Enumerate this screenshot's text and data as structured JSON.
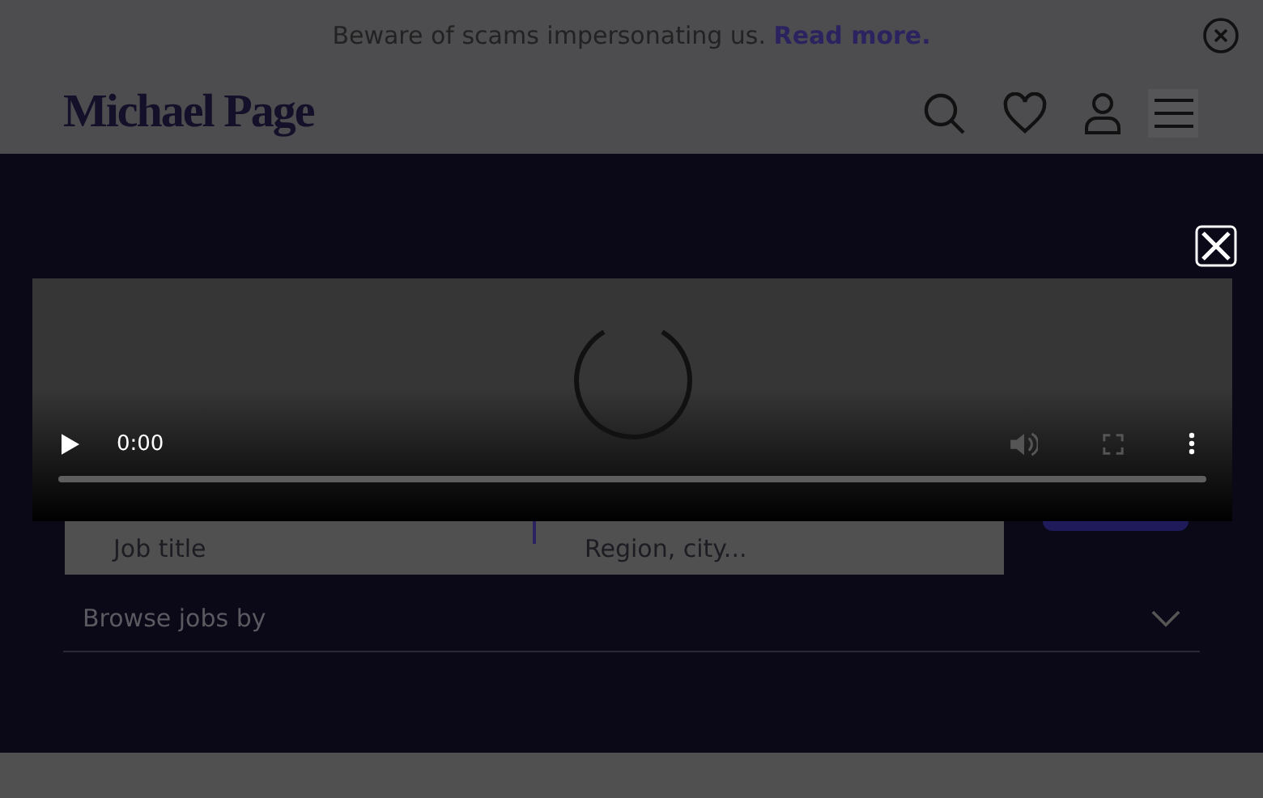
{
  "banner": {
    "message": "Beware of scams impersonating us.",
    "link": "Read more."
  },
  "header": {
    "logo": "Michael Page"
  },
  "search": {
    "job_field": {
      "placeholder": "Job title"
    },
    "location_field": {
      "placeholder": "Region, city..."
    }
  },
  "browse": {
    "label": "Browse jobs by",
    "expanded": false
  },
  "video": {
    "time": "0:00"
  }
}
